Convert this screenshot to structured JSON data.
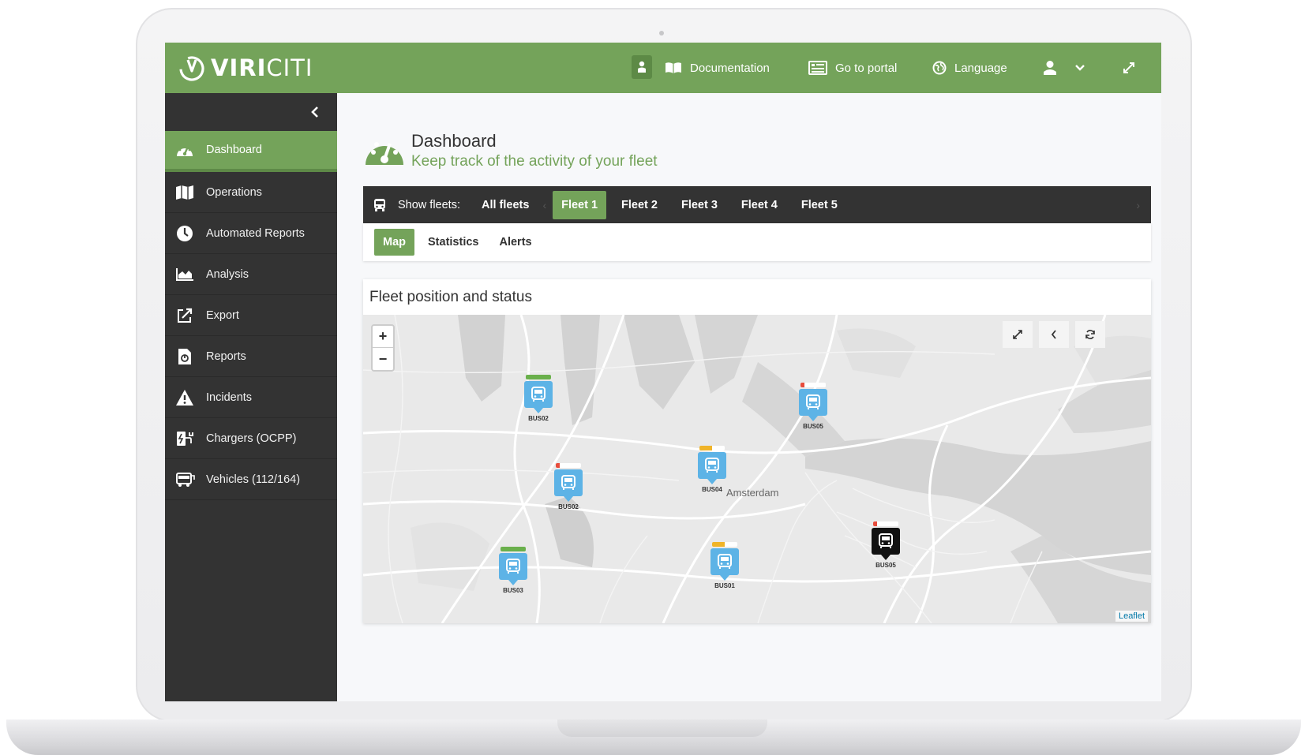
{
  "app": {
    "logo_bold": "VIRI",
    "logo_rest": "CITI"
  },
  "topbar": {
    "documentation": "Documentation",
    "portal": "Go to portal",
    "language": "Language"
  },
  "sidebar": {
    "items": [
      {
        "label": "Dashboard",
        "icon": "dashboard-icon",
        "active": true
      },
      {
        "label": "Operations",
        "icon": "map-icon"
      },
      {
        "label": "Automated Reports",
        "icon": "clock-icon"
      },
      {
        "label": "Analysis",
        "icon": "area-chart-icon"
      },
      {
        "label": "Export",
        "icon": "export-icon"
      },
      {
        "label": "Reports",
        "icon": "report-file-icon"
      },
      {
        "label": "Incidents",
        "icon": "warning-icon"
      },
      {
        "label": "Chargers (OCPP)",
        "icon": "charger-icon"
      },
      {
        "label": "Vehicles (112/164)",
        "icon": "bus-icon"
      }
    ]
  },
  "header": {
    "title": "Dashboard",
    "subtitle": "Keep track of the activity of your fleet"
  },
  "fleets": {
    "label": "Show fleets:",
    "items": [
      "All fleets",
      "Fleet 1",
      "Fleet 2",
      "Fleet 3",
      "Fleet 4",
      "Fleet 5"
    ],
    "selected": "Fleet 1"
  },
  "tabs": {
    "items": [
      "Map",
      "Statistics",
      "Alerts"
    ],
    "selected": "Map"
  },
  "panel": {
    "title": "Fleet position and status",
    "city_label": "Amsterdam",
    "attribution": "Leaflet",
    "zoom_in": "+",
    "zoom_out": "−"
  },
  "buses": [
    {
      "id": "BUS02",
      "battery": 1.0,
      "battery_color": "#6ab04c",
      "dark": false
    },
    {
      "id": "BUS05",
      "battery": 0.15,
      "battery_color": "#e74c3c",
      "dark": false
    },
    {
      "id": "BUS04",
      "battery": 0.5,
      "battery_color": "#f0b429",
      "dark": false
    },
    {
      "id": "BUS02",
      "battery": 0.15,
      "battery_color": "#e74c3c",
      "dark": false
    },
    {
      "id": "BUS03",
      "battery": 1.0,
      "battery_color": "#6ab04c",
      "dark": false
    },
    {
      "id": "BUS01",
      "battery": 0.5,
      "battery_color": "#f0b429",
      "dark": false
    },
    {
      "id": "BUS05",
      "battery": 0.15,
      "battery_color": "#e74c3c",
      "dark": true
    }
  ],
  "colors": {
    "brand": "#74a35a",
    "sidebar": "#333333",
    "marker": "#5db3e6"
  }
}
